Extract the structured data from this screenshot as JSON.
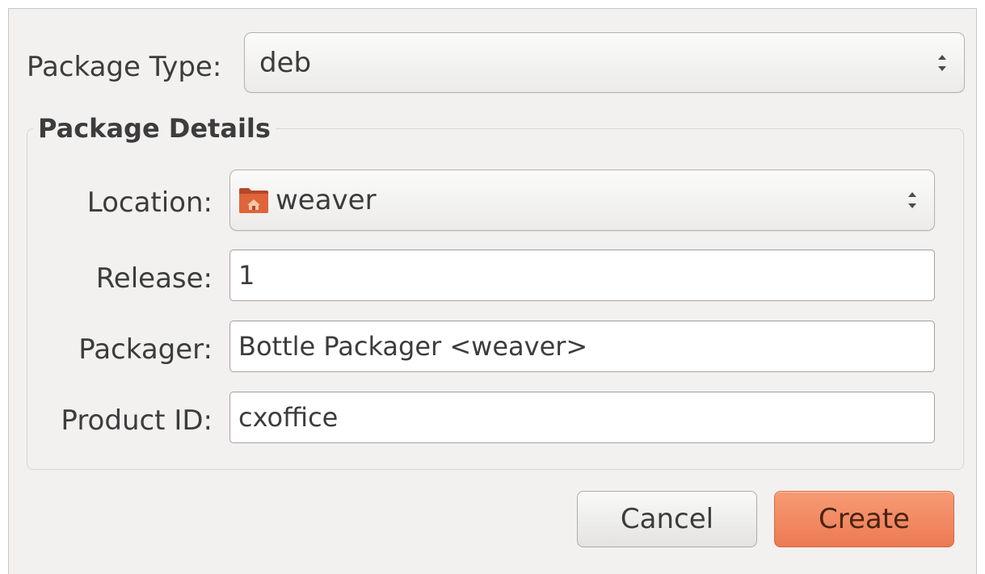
{
  "package_type": {
    "label": "Package Type:",
    "selected": "deb"
  },
  "details": {
    "title": "Package Details",
    "location": {
      "label": "Location:",
      "selected": "weaver",
      "icon": "folder-home-icon"
    },
    "release": {
      "label": "Release:",
      "value": "1"
    },
    "packager": {
      "label": "Packager:",
      "value": "Bottle Packager <weaver>"
    },
    "product_id": {
      "label": "Product ID:",
      "value": "cxoffice"
    }
  },
  "actions": {
    "cancel_label": "Cancel",
    "create_label": "Create"
  },
  "colors": {
    "dialog_bg": "#f2f1f0",
    "accent": "#ec7a52"
  }
}
